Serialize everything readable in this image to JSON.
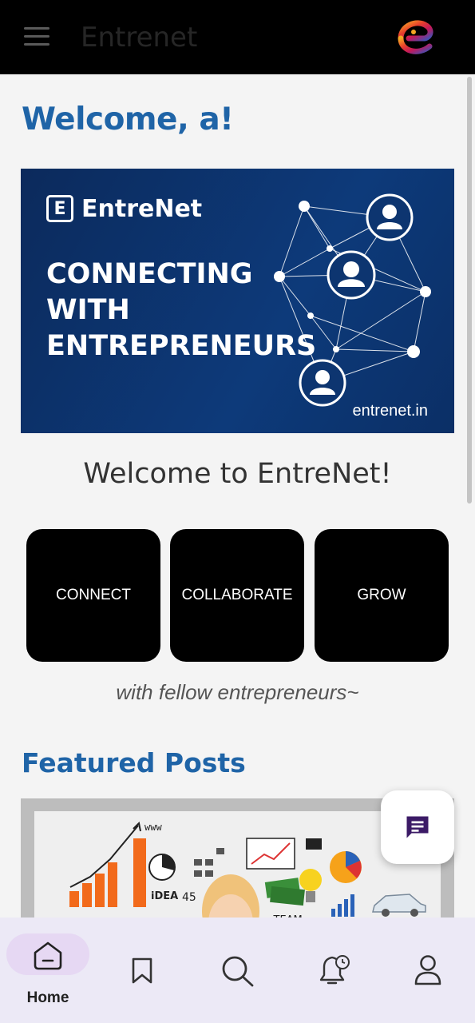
{
  "header": {
    "title": "Entrenet",
    "menu_icon": "hamburger-menu-icon",
    "logo_icon": "entrenet-logo-icon"
  },
  "welcome": {
    "greeting": "Welcome, a!"
  },
  "banner": {
    "brand_letter": "E",
    "brand_name": "EntreNet",
    "headline": [
      "CONNECTING",
      "WITH",
      "ENTREPRENEURS"
    ],
    "url": "entrenet.in"
  },
  "intro": {
    "heading": "Welcome to EntreNet!",
    "tagline": "with fellow entrepreneurs~"
  },
  "pillars": [
    {
      "label": "CONNECT"
    },
    {
      "label": "COLLABORATE"
    },
    {
      "label": "GROW"
    }
  ],
  "featured": {
    "heading": "Featured Posts"
  },
  "fab": {
    "icon": "chat-icon"
  },
  "bottom_nav": {
    "items": [
      {
        "label": "Home",
        "icon": "home-icon",
        "active": true
      },
      {
        "label": "",
        "icon": "bookmark-icon"
      },
      {
        "label": "",
        "icon": "search-icon"
      },
      {
        "label": "",
        "icon": "notification-bell-icon"
      },
      {
        "label": "",
        "icon": "profile-icon"
      }
    ]
  },
  "colors": {
    "accent_blue": "#1f64a7",
    "banner_navy": "#0c2a5c",
    "nav_bg": "#ece9f6",
    "active_pill": "#e6d8f3",
    "fab_icon": "#3b1a66"
  }
}
